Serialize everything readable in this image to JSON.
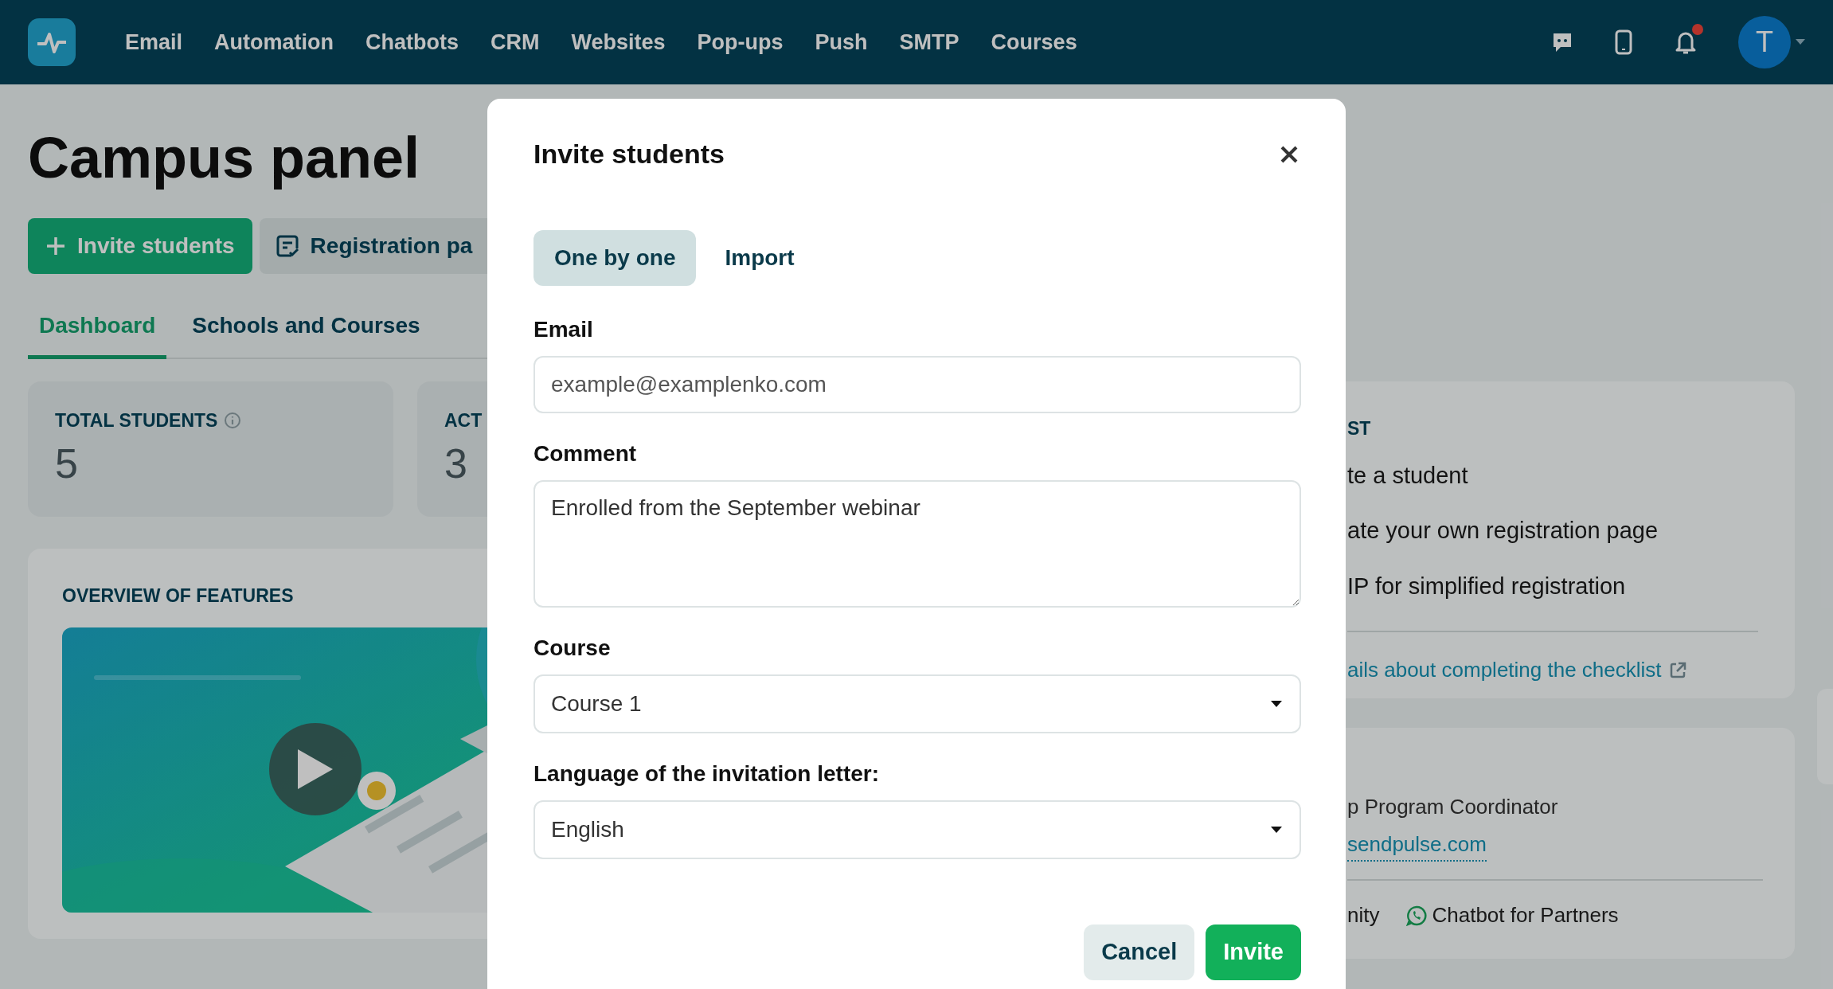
{
  "nav": {
    "items": [
      "Email",
      "Automation",
      "Chatbots",
      "CRM",
      "Websites",
      "Pop-ups",
      "Push",
      "SMTP",
      "Courses"
    ],
    "notification_dot": true,
    "avatar": "T"
  },
  "page": {
    "title": "Campus panel",
    "actions": [
      {
        "kind": "primary",
        "label": "Invite students"
      },
      {
        "kind": "secondary",
        "label": "Registration pa"
      }
    ],
    "tabs": [
      {
        "label": "Dashboard",
        "selected": true
      },
      {
        "label": "Schools and Courses",
        "selected": false
      }
    ],
    "stats": [
      {
        "kind": "with_info",
        "label": "TOTAL STUDENTS",
        "value": "5"
      },
      {
        "kind": "plain",
        "label": "ACT",
        "value": "3"
      }
    ],
    "features": {
      "title": "OVERVIEW OF FEATURES"
    },
    "checklist": {
      "title": "ST",
      "items": [
        "te a student",
        "ate your own registration page",
        "IP for simplified registration"
      ],
      "link": "ails about completing the checklist"
    },
    "contact": {
      "role": "p Program Coordinator",
      "email": "sendpulse.com",
      "links": [
        "nity",
        "Chatbot for Partners"
      ]
    }
  },
  "dialog": {
    "title": "Invite students",
    "tabs": [
      {
        "label": "One by one",
        "selected": true
      },
      {
        "label": "Import",
        "selected": false
      }
    ],
    "fields": [
      {
        "kind": "input",
        "label": "Email",
        "placeholder": "example@examplenko.com"
      },
      {
        "kind": "textarea",
        "label": "Comment",
        "value": "Enrolled from the September webinar"
      },
      {
        "kind": "select",
        "label": "Course",
        "value": "Course 1"
      },
      {
        "kind": "select",
        "label": "Language of the invitation letter:",
        "value": "English"
      }
    ],
    "buttons": [
      {
        "kind": "secondary",
        "label": "Cancel"
      },
      {
        "kind": "primary",
        "label": "Invite"
      }
    ]
  }
}
